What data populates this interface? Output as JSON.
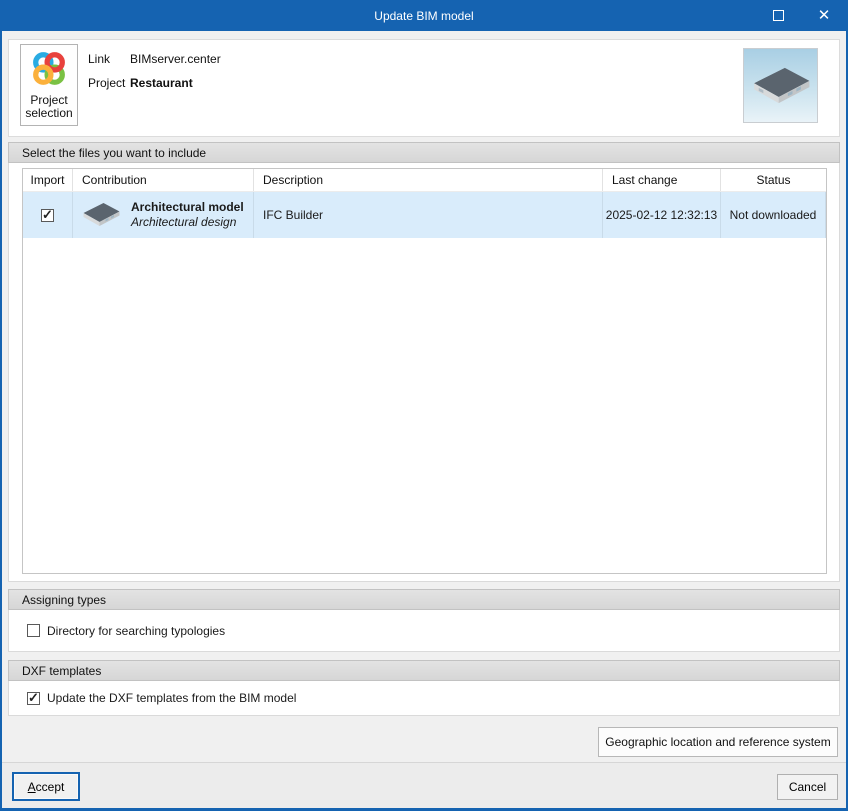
{
  "window": {
    "title": "Update BIM model"
  },
  "colors": {
    "accent": "#1563b1",
    "row_highlight": "#d9ecfb"
  },
  "icons": {
    "check": "✓",
    "close": "✕"
  },
  "header": {
    "project_button_label": "Project selection",
    "link_label": "Link",
    "link_value": "BIMserver.center",
    "project_label": "Project",
    "project_value": "Restaurant"
  },
  "files": {
    "section_title": "Select the files you want to include",
    "columns": [
      "Import",
      "Contribution",
      "Description",
      "Last change",
      "Status"
    ],
    "rows": [
      {
        "import": true,
        "title": "Architectural model",
        "subtitle": "Architectural design",
        "description": "IFC Builder",
        "last_change": "2025-02-12 12:32:13",
        "status": "Not downloaded"
      }
    ]
  },
  "assigning_types": {
    "section_title": "Assigning types",
    "checkbox_label": "Directory for searching typologies",
    "checked": false
  },
  "dxf": {
    "section_title": "DXF templates",
    "checkbox_label": "Update the DXF templates from the BIM model",
    "checked": true
  },
  "footer": {
    "geo_button": "Geographic location and reference system",
    "accept_mnemonic": "A",
    "accept_rest": "ccept",
    "cancel": "Cancel"
  }
}
